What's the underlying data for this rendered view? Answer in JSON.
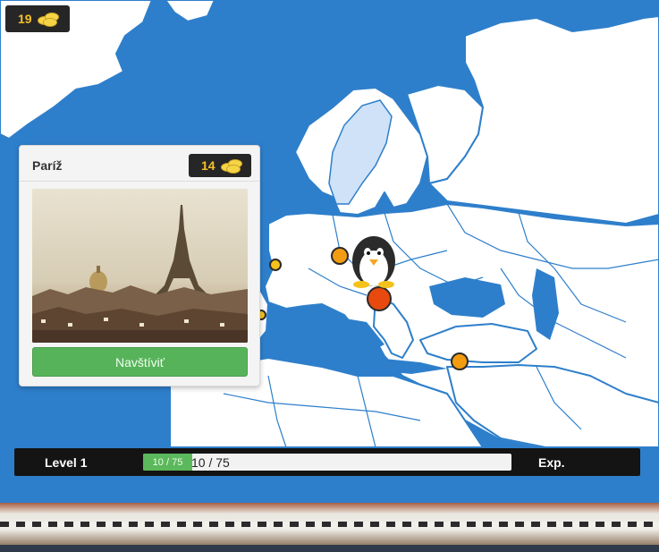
{
  "hud": {
    "coins": "19"
  },
  "city_card": {
    "title": "Paríž",
    "cost": "14",
    "visit_label": "Navštíviť"
  },
  "level_bar": {
    "level_label": "Level 1",
    "progress_inner": "10 / 75",
    "progress_text": "10 / 75",
    "progress_fraction": 0.1333,
    "exp_label": "Exp."
  },
  "colors": {
    "ocean": "#2e7fcb",
    "land": "#ffffff",
    "coin": "#f6c02b",
    "visit_button": "#57b35a",
    "marker_orange": "#f39c12",
    "marker_red": "#e8490f"
  }
}
